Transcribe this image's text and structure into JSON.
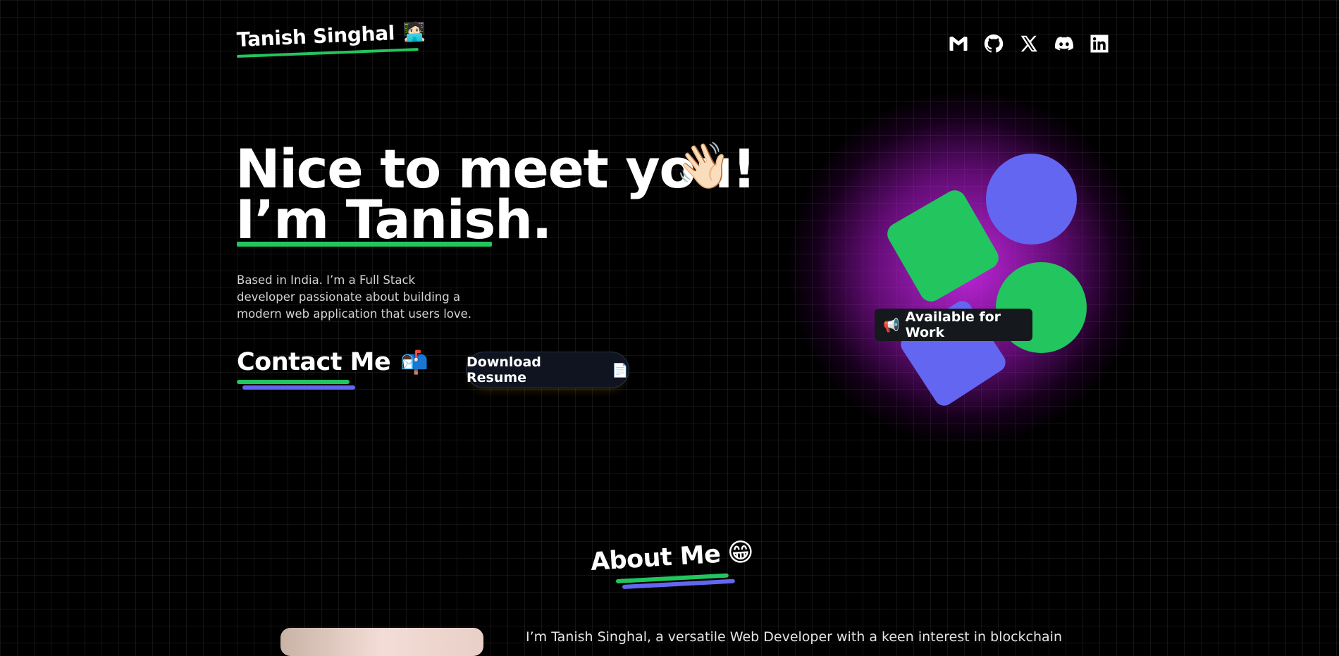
{
  "header": {
    "logo_text": "Tanish Singhal",
    "logo_emoji": "🧑🏻‍💻",
    "social_icons": [
      "gmail-icon",
      "github-icon",
      "x-icon",
      "discord-icon",
      "linkedin-icon"
    ]
  },
  "hero": {
    "line1": "Nice to meet you!",
    "wave_emoji": "👋🏻",
    "line2": "I’m Tanish.",
    "intro": "Based in India. I’m a Full Stack developer passionate about building a modern web application that users love.",
    "contact_label": "Contact Me",
    "contact_emoji": "📬",
    "resume_label": "Download Resume",
    "resume_emoji": "📄"
  },
  "art": {
    "badge_emoji": "📢",
    "badge_label": "Available for Work",
    "colors": {
      "green": "#22c55e",
      "indigo": "#6366f1",
      "glow": "#c026d3"
    }
  },
  "about": {
    "title": "About Me",
    "emoji": "😁",
    "text": "I’m Tanish Singhal, a versatile Web Developer with a keen interest in blockchain"
  },
  "colors": {
    "background": "#000000",
    "accent_green": "#22c55e",
    "accent_indigo": "#6366f1"
  }
}
